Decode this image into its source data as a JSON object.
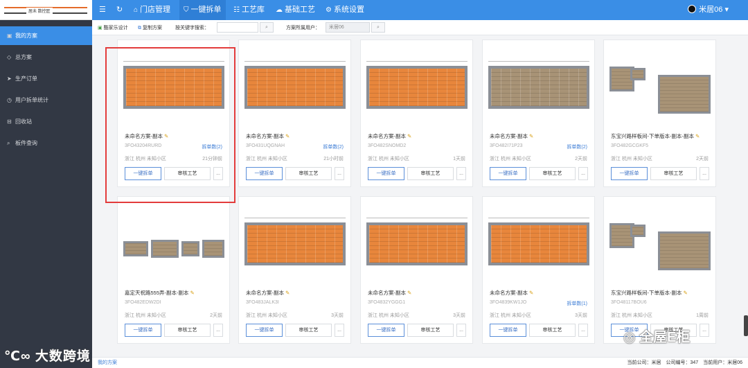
{
  "header": {
    "logo_text": "居未 数控匠",
    "nav": [
      {
        "label": "门店管理",
        "icon": "home-icon"
      },
      {
        "label": "一键拆单",
        "icon": "shield-icon"
      },
      {
        "label": "工艺库",
        "icon": "list-icon"
      },
      {
        "label": "基础工艺",
        "icon": "cloud-icon"
      },
      {
        "label": "系统设置",
        "icon": "gear-icon"
      }
    ],
    "user": "米居06",
    "colors": {
      "bar": "#3a8ee6",
      "sidebar": "#323844",
      "highlight": "#e33b3b"
    }
  },
  "sidebar": {
    "items": [
      {
        "label": "我的方案",
        "icon": "folder-icon"
      },
      {
        "label": "总方案",
        "icon": "diamond-icon"
      },
      {
        "label": "生产订单",
        "icon": "send-icon"
      },
      {
        "label": "用户拆单统计",
        "icon": "clock-icon"
      },
      {
        "label": "回收站",
        "icon": "trash-icon"
      },
      {
        "label": "板件查询",
        "icon": "search-icon"
      }
    ]
  },
  "toolbar": {
    "design_label": "酷家乐设计",
    "copy_label": "复制方案",
    "search_label": "按关键字搜索：",
    "search_placeholder": "",
    "owner_label": "方案所属用户：",
    "owner_value": "米居06"
  },
  "cards": [
    {
      "name": "未命名方案-副本",
      "code": "3FO43204RURD",
      "count": "拆单数(2)",
      "location": "浙江 杭州 未知小区",
      "time": "21分钟前",
      "primary": "一键拆单",
      "review": "审核工艺",
      "more": "..."
    },
    {
      "name": "未命名方案-副本",
      "code": "3FO431UQGNAH",
      "count": "拆单数(2)",
      "location": "浙江 杭州 未知小区",
      "time": "21小时前",
      "primary": "一键拆单",
      "review": "审核工艺",
      "more": "..."
    },
    {
      "name": "未命名方案-副本",
      "code": "3FO482SNOMD2",
      "count": "",
      "location": "浙江 杭州 未知小区",
      "time": "1天前",
      "primary": "一键拆单",
      "review": "审核工艺",
      "more": "..."
    },
    {
      "name": "未命名方案-副本",
      "code": "3FO482I71P23",
      "count": "拆单数(2)",
      "location": "浙江 杭州 未知小区",
      "time": "2天前",
      "primary": "一键拆单",
      "review": "审核工艺",
      "more": "..."
    },
    {
      "name": "东宝兴路样板间-下单版本-副本-副本",
      "code": "3FO482GCGKF5",
      "count": "",
      "location": "浙江 杭州 未知小区",
      "time": "2天前",
      "primary": "一键拆单",
      "review": "审核工艺",
      "more": "..."
    },
    {
      "name": "嘉定天祝路555弄-副本-副本",
      "code": "3FO482EDW2DI",
      "count": "",
      "location": "浙江 杭州 未知小区",
      "time": "2天前",
      "primary": "一键拆单",
      "review": "审核工艺",
      "more": "..."
    },
    {
      "name": "未命名方案-副本",
      "code": "3FO483JALK3I",
      "count": "",
      "location": "浙江 杭州 未知小区",
      "time": "3天前",
      "primary": "一键拆单",
      "review": "审核工艺",
      "more": "..."
    },
    {
      "name": "未命名方案-副本",
      "code": "3FO4832YGGG1",
      "count": "",
      "location": "浙江 杭州 未知小区",
      "time": "3天前",
      "primary": "一键拆单",
      "review": "审核工艺",
      "more": "..."
    },
    {
      "name": "未命名方案-副本",
      "code": "3FO4839KW1JO",
      "count": "拆单数(1)",
      "location": "浙江 杭州 未知小区",
      "time": "3天前",
      "primary": "一键拆单",
      "review": "审核工艺",
      "more": "..."
    },
    {
      "name": "东宝兴路样板间-下单版本-副本",
      "code": "3FO48117BOU6",
      "count": "",
      "location": "浙江 杭州 未知小区",
      "time": "1周前",
      "primary": "一键拆单",
      "review": "审核工艺",
      "more": "..."
    }
  ],
  "footer": {
    "breadcrumb": "我的方案",
    "company": "当前公司：米居",
    "company_no": "公司编号：347",
    "current_user": "当前用户：米居06"
  },
  "watermarks": {
    "left": "大数跨境",
    "right": "全屋E柜"
  }
}
